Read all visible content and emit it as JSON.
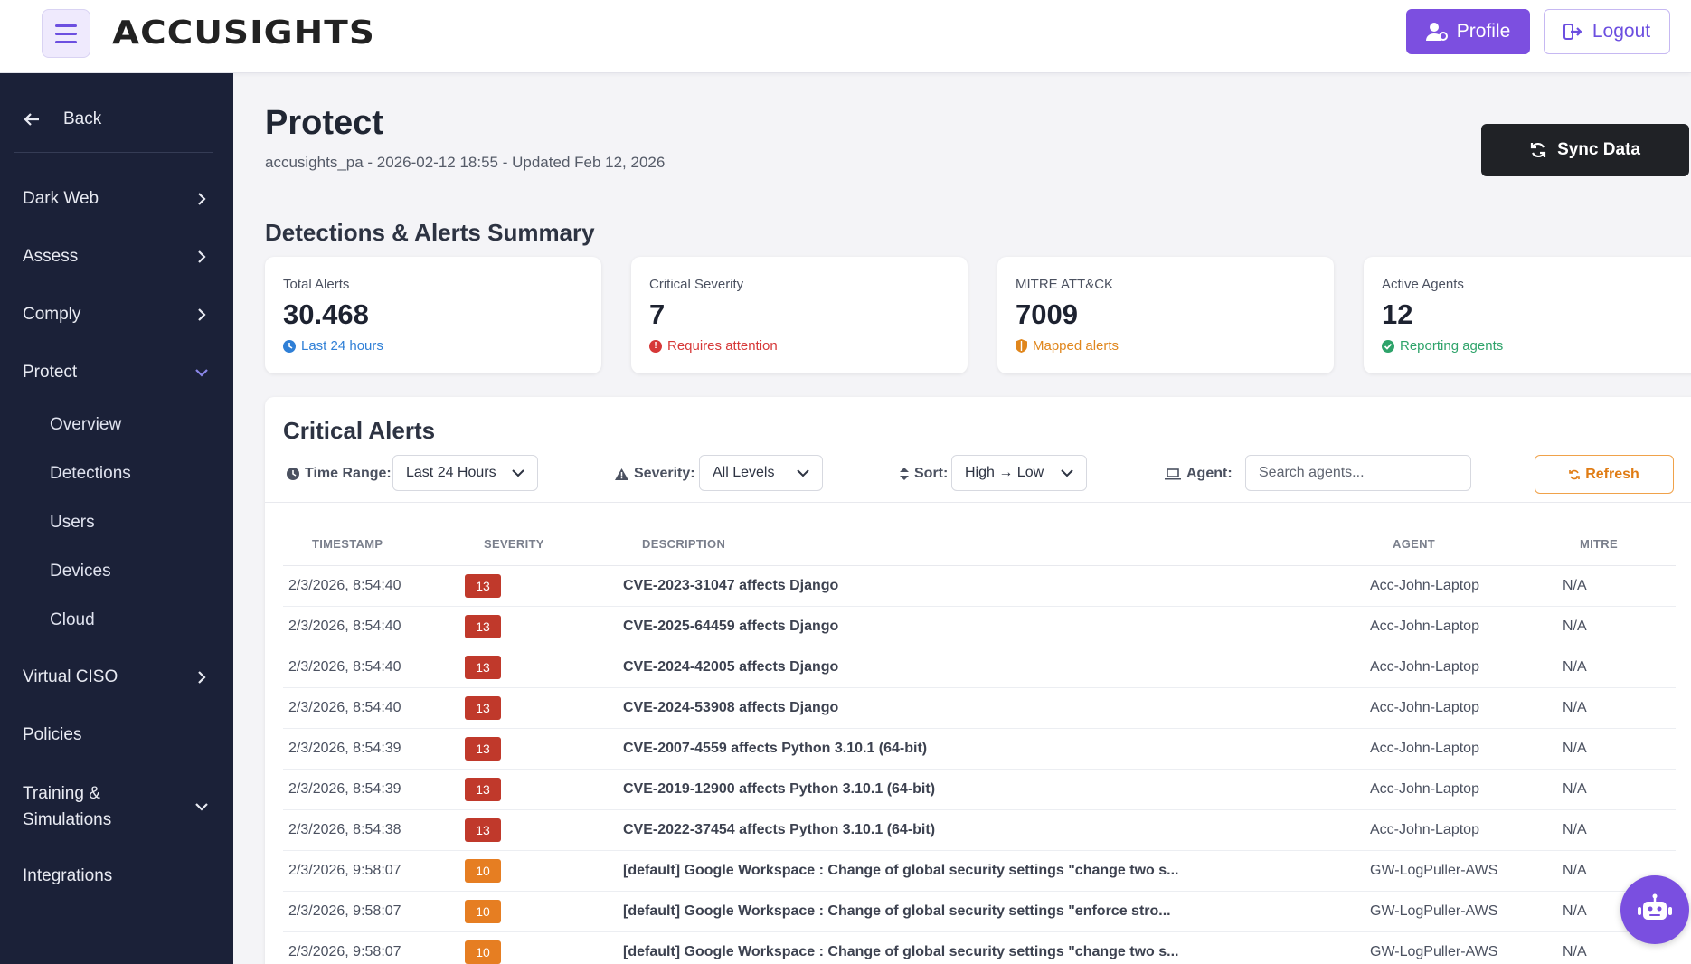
{
  "header": {
    "brand": "ACCUSIGHTS",
    "profile_label": "Profile",
    "logout_label": "Logout"
  },
  "sidebar": {
    "back_label": "Back",
    "items": [
      {
        "label": "Dark Web",
        "state": "collapsed"
      },
      {
        "label": "Assess",
        "state": "collapsed"
      },
      {
        "label": "Comply",
        "state": "collapsed"
      },
      {
        "label": "Protect",
        "state": "expanded"
      },
      {
        "label": "Virtual CISO",
        "state": "collapsed"
      },
      {
        "label": "Policies"
      },
      {
        "label": "Training &",
        "label2": "Simulations",
        "state": "expanded"
      },
      {
        "label": "Integrations"
      }
    ],
    "protect_sub": [
      "Overview",
      "Detections",
      "Users",
      "Devices",
      "Cloud"
    ]
  },
  "page": {
    "title": "Protect",
    "subtitle": "accusights_pa - 2026-02-12 18:55 - Updated Feb 12, 2026",
    "sync_label": "Sync Data",
    "summary_title": "Detections & Alerts Summary"
  },
  "cards": [
    {
      "label": "Total Alerts",
      "value": "30.468",
      "note": "Last 24 hours",
      "color": "#2f7fd6",
      "icon": "clock-icon"
    },
    {
      "label": "Critical Severity",
      "value": "7",
      "note": "Requires attention",
      "color": "#d63838",
      "icon": "alert-icon"
    },
    {
      "label": "MITRE ATT&CK",
      "value": "7009",
      "note": "Mapped alerts",
      "color": "#e0861c",
      "icon": "shield-icon"
    },
    {
      "label": "Active Agents",
      "value": "12",
      "note": "Reporting agents",
      "color": "#2ea36a",
      "icon": "check-icon"
    }
  ],
  "alerts": {
    "title": "Critical Alerts",
    "time_range_label": "Time Range:",
    "time_range_value": "Last 24 Hours",
    "severity_label": "Severity:",
    "severity_value": "All Levels",
    "sort_label": "Sort:",
    "sort_value": "High → Low",
    "agent_label": "Agent:",
    "agent_placeholder": "Search agents...",
    "refresh_label": "Refresh",
    "columns": [
      "TIMESTAMP",
      "SEVERITY",
      "DESCRIPTION",
      "AGENT",
      "MITRE"
    ],
    "rows": [
      {
        "timestamp": "2/3/2026, 8:54:40",
        "severity": "13",
        "description": "CVE-2023-31047 affects Django",
        "agent": "Acc-John-Laptop",
        "mitre": "N/A"
      },
      {
        "timestamp": "2/3/2026, 8:54:40",
        "severity": "13",
        "description": "CVE-2025-64459 affects Django",
        "agent": "Acc-John-Laptop",
        "mitre": "N/A"
      },
      {
        "timestamp": "2/3/2026, 8:54:40",
        "severity": "13",
        "description": "CVE-2024-42005 affects Django",
        "agent": "Acc-John-Laptop",
        "mitre": "N/A"
      },
      {
        "timestamp": "2/3/2026, 8:54:40",
        "severity": "13",
        "description": "CVE-2024-53908 affects Django",
        "agent": "Acc-John-Laptop",
        "mitre": "N/A"
      },
      {
        "timestamp": "2/3/2026, 8:54:39",
        "severity": "13",
        "description": "CVE-2007-4559 affects Python 3.10.1 (64-bit)",
        "agent": "Acc-John-Laptop",
        "mitre": "N/A"
      },
      {
        "timestamp": "2/3/2026, 8:54:39",
        "severity": "13",
        "description": "CVE-2019-12900 affects Python 3.10.1 (64-bit)",
        "agent": "Acc-John-Laptop",
        "mitre": "N/A"
      },
      {
        "timestamp": "2/3/2026, 8:54:38",
        "severity": "13",
        "description": "CVE-2022-37454 affects Python 3.10.1 (64-bit)",
        "agent": "Acc-John-Laptop",
        "mitre": "N/A"
      },
      {
        "timestamp": "2/3/2026, 9:58:07",
        "severity": "10",
        "description": "[default] Google Workspace : Change of global security settings \"change two s...",
        "agent": "GW-LogPuller-AWS",
        "mitre": "N/A"
      },
      {
        "timestamp": "2/3/2026, 9:58:07",
        "severity": "10",
        "description": "[default] Google Workspace : Change of global security settings \"enforce stro...",
        "agent": "GW-LogPuller-AWS",
        "mitre": "N/A"
      },
      {
        "timestamp": "2/3/2026, 9:58:07",
        "severity": "10",
        "description": "[default] Google Workspace : Change of global security settings \"change two s...",
        "agent": "GW-LogPuller-AWS",
        "mitre": "N/A"
      }
    ]
  },
  "colors": {
    "severity_13": "#c0392b",
    "severity_10": "#e67e22",
    "accent": "#7c4fe0",
    "sidebar_bg": "#1b2138"
  }
}
